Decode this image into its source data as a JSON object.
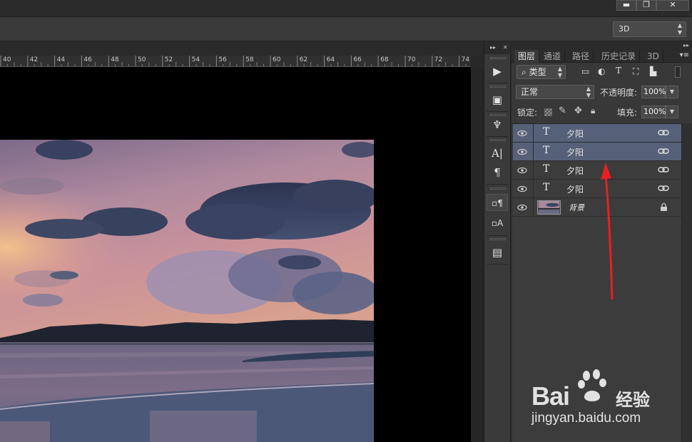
{
  "window": {
    "min_glyph": "▬",
    "max_glyph": "❐",
    "close_glyph": "✕"
  },
  "options_bar": {
    "mode_value": "3D"
  },
  "ruler": {
    "labels": [
      "40",
      "42",
      "44",
      "46",
      "48",
      "50",
      "52",
      "54",
      "56",
      "58",
      "60",
      "62",
      "64",
      "66",
      "68",
      "70",
      "72",
      "74"
    ]
  },
  "panel": {
    "tabs": [
      {
        "label": "图层",
        "active": true
      },
      {
        "label": "通道",
        "active": false
      },
      {
        "label": "路径",
        "active": false
      },
      {
        "label": "历史记录",
        "active": false
      },
      {
        "label": "3D",
        "active": false
      }
    ],
    "filter_value": "类型",
    "blend_mode": "正常",
    "opacity_label": "不透明度:",
    "opacity_value": "100%",
    "lock_label": "锁定:",
    "fill_label": "填充:",
    "fill_value": "100%"
  },
  "layers": [
    {
      "type": "text",
      "name": "夕阳",
      "selected": true,
      "visible": true
    },
    {
      "type": "text",
      "name": "夕阳",
      "selected": true,
      "visible": true
    },
    {
      "type": "text",
      "name": "夕阳",
      "selected": false,
      "visible": true
    },
    {
      "type": "text",
      "name": "夕阳",
      "selected": false,
      "visible": true
    },
    {
      "type": "image",
      "name": "背景",
      "selected": false,
      "visible": true,
      "locked": true
    }
  ],
  "watermark": {
    "brand": "Bai",
    "brand_cn": "经验",
    "url": "jingyan.baidu.com"
  },
  "colors": {
    "selected_row": "#566078",
    "annotation_arrow": "#e82020"
  }
}
